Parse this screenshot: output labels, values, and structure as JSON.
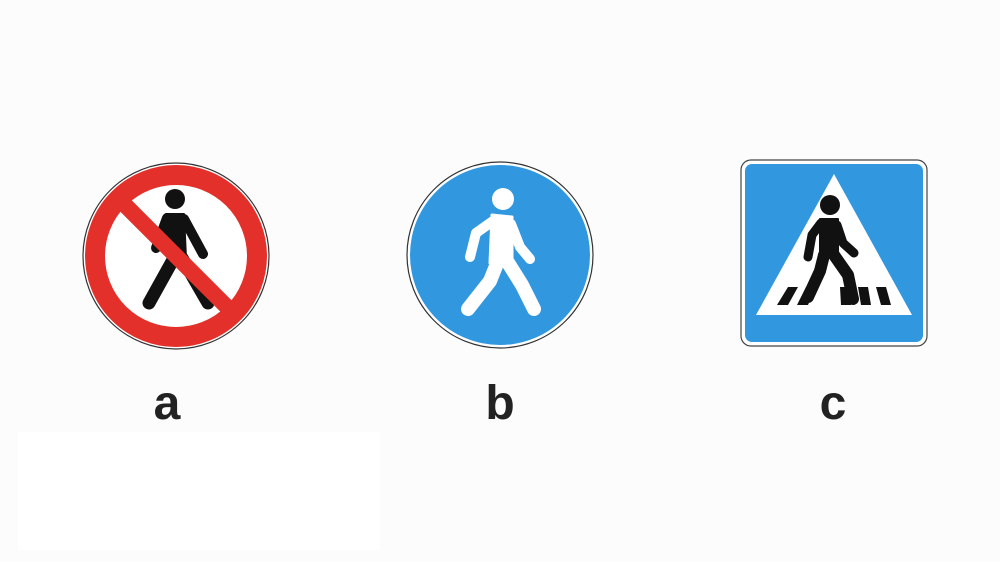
{
  "signs": [
    {
      "label": "a",
      "icon": "no-pedestrians-sign-icon",
      "colors": {
        "ring": "#e3302a",
        "background": "#ffffff",
        "figure": "#111111",
        "slash": "#e3302a"
      }
    },
    {
      "label": "b",
      "icon": "pedestrian-path-sign-icon",
      "colors": {
        "background": "#3198e0",
        "figure": "#ffffff"
      }
    },
    {
      "label": "c",
      "icon": "pedestrian-crossing-sign-icon",
      "colors": {
        "background": "#3198e0",
        "triangle": "#ffffff",
        "figure": "#111111"
      }
    }
  ]
}
